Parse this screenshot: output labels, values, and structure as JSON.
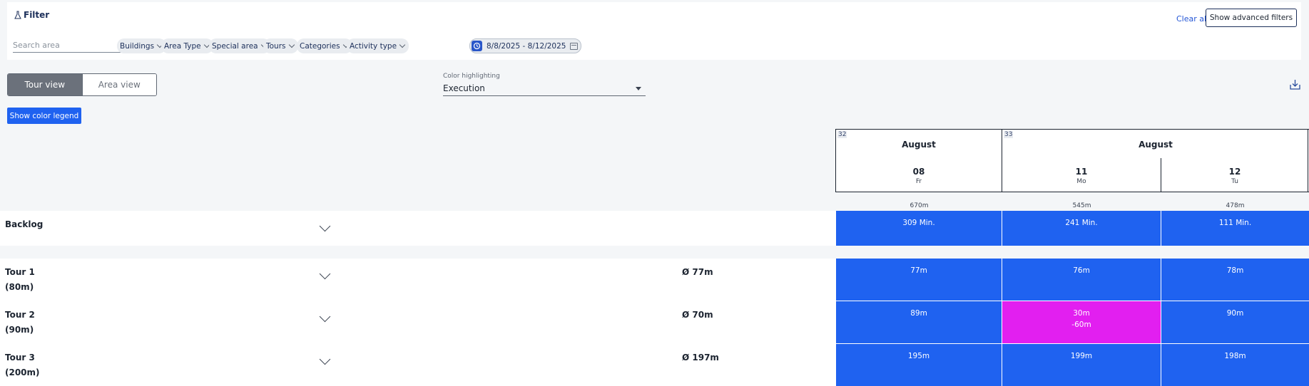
{
  "filter": {
    "title": "Filter",
    "search_placeholder": "Search area",
    "chips": [
      "Buildings",
      "Area Type",
      "Special area",
      "Tours",
      "Categories",
      "Activity type"
    ],
    "date_range": "8/8/2025 - 8/12/2025",
    "clear_all": "Clear all",
    "advanced": "Show advanced filters"
  },
  "view_toggle": {
    "tour": "Tour view",
    "area": "Area view"
  },
  "color_highlighting": {
    "label": "Color highlighting",
    "value": "Execution"
  },
  "legend_button": "Show color legend",
  "calendar": {
    "weeks": [
      {
        "week": "32",
        "month": "August",
        "days": [
          {
            "num": "08",
            "wd": "Fr",
            "total": "670m"
          }
        ]
      },
      {
        "week": "33",
        "month": "August",
        "days": [
          {
            "num": "11",
            "wd": "Mo",
            "total": "545m"
          },
          {
            "num": "12",
            "wd": "Tu",
            "total": "478m"
          }
        ]
      }
    ]
  },
  "backlog": {
    "label": "Backlog",
    "cells": [
      "309 Min.",
      "241 Min.",
      "111 Min."
    ]
  },
  "tours": [
    {
      "name": "Tour 1",
      "planned": "(80m)",
      "avg": "Ø 77m",
      "cells": [
        {
          "value": "77m"
        },
        {
          "value": "76m"
        },
        {
          "value": "78m"
        }
      ]
    },
    {
      "name": "Tour 2",
      "planned": "(90m)",
      "avg": "Ø 70m",
      "cells": [
        {
          "value": "89m"
        },
        {
          "value": "30m",
          "delta": "-60m",
          "highlight": "#e21ff0"
        },
        {
          "value": "90m"
        }
      ]
    },
    {
      "name": "Tour 3",
      "planned": "(200m)",
      "avg": "Ø 197m",
      "cells": [
        {
          "value": "195m"
        },
        {
          "value": "199m"
        },
        {
          "value": "198m"
        }
      ]
    }
  ],
  "colors": {
    "cell_blue": "#1f62f0",
    "cell_magenta": "#e21ff0",
    "toggle_active": "#6b717b"
  }
}
